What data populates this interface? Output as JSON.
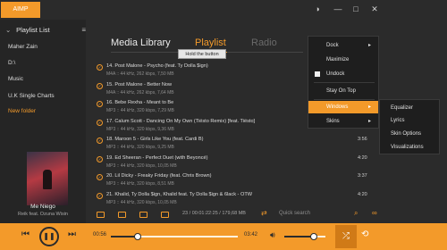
{
  "app": {
    "badge": "AIMP"
  },
  "window_controls": {
    "theme": "◑",
    "minimize": "—",
    "maximize": "□",
    "close": "✕"
  },
  "sidebar": {
    "header": "Playlist List",
    "menu_icon": "≡",
    "items": [
      {
        "label": "Maher Zain",
        "active": false
      },
      {
        "label": "D:\\",
        "active": false
      },
      {
        "label": "Music",
        "active": false
      },
      {
        "label": "U.K Single Charts",
        "active": false
      },
      {
        "label": "New folder",
        "active": true
      }
    ],
    "now_playing": {
      "title": "Me Niego",
      "artist": "Reik feat. Ozuna Wisin"
    }
  },
  "tabs": [
    {
      "label": "Media Library"
    },
    {
      "label": "Playlist"
    },
    {
      "label": "Radio"
    }
  ],
  "tooltip": "Hold the button",
  "tracks": [
    {
      "title": "14. Post Malone - Psycho (feat. Ty Dolla $ign)",
      "meta": "M4A :: 44 kHz, 262 kbps, 7,50 MB",
      "duration": ""
    },
    {
      "title": "15. Post Malone - Better Now",
      "meta": "M4A :: 44 kHz, 262 kbps, 7,64 MB",
      "duration": ""
    },
    {
      "title": "16. Bebe Rexha - Meant to Be",
      "meta": "MP3 :: 44 kHz, 320 kbps, 7,29 MB",
      "duration": ""
    },
    {
      "title": "17. Calum Scott - Dancing On My Own (Tiësto Remix) [feat. Tiësto]",
      "meta": "MP3 :: 44 kHz, 320 kbps, 9,36 MB",
      "duration": ""
    },
    {
      "title": "18. Maroon 5 - Girls Like You (feat. Cardi B)",
      "meta": "MP3 :: 44 kHz, 320 kbps, 9,25 MB",
      "duration": "3:56"
    },
    {
      "title": "19. Ed Sheeran - Perfect Duet (with Beyoncé)",
      "meta": "MP3 :: 44 kHz, 320 kbps, 10,05 MB",
      "duration": "4:20"
    },
    {
      "title": "20. Lil Dicky - Freaky Friday (feat. Chris Brown)",
      "meta": "MP3 :: 44 kHz, 320 kbps, 8,51 MB",
      "duration": "3:37"
    },
    {
      "title": "21. Khalid, Ty Dolla $ign, Khalid feat. Ty Dolla $ign & 6lack - OTW",
      "meta": "MP3 :: 44 kHz, 320 kbps, 10,05 MB",
      "duration": "4:20"
    }
  ],
  "toolbar": {
    "info": "23 / 00:01:22:25 / 179,68 MB",
    "search_placeholder": "Quick search"
  },
  "player": {
    "elapsed": "00:56",
    "remaining": "03:42",
    "seek_fraction": 0.21,
    "volume_fraction": 0.72
  },
  "context_menu": {
    "items": [
      {
        "label": "Dock",
        "submenu": true,
        "checked": false,
        "highlight": false
      },
      {
        "label": "Maximize",
        "submenu": false,
        "checked": false,
        "highlight": false
      },
      {
        "label": "Undock",
        "submenu": false,
        "checked": true,
        "highlight": false
      },
      {
        "label": "Stay On Top",
        "submenu": false,
        "checked": false,
        "highlight": false
      },
      {
        "label": "Windows",
        "submenu": true,
        "checked": false,
        "highlight": true
      },
      {
        "label": "Skins",
        "submenu": true,
        "checked": false,
        "highlight": false
      }
    ],
    "submenu": [
      {
        "label": "Equalizer"
      },
      {
        "label": "Lyrics"
      },
      {
        "label": "Skin Options"
      },
      {
        "label": "Visualizations"
      }
    ]
  },
  "colors": {
    "accent": "#f39a2a",
    "background": "#2b2b2b",
    "sidebar": "#252525",
    "menu": "#1e1e1e"
  }
}
